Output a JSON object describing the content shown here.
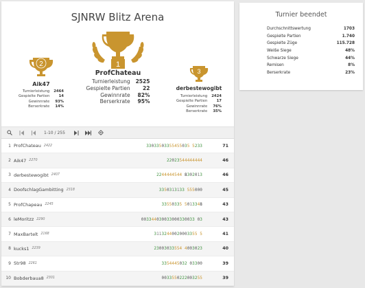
{
  "arena": {
    "title": "SJNRW Blitz Arena"
  },
  "podium": {
    "first": {
      "rank": "1",
      "name": "ProfChateau",
      "stats": [
        {
          "label": "Turnierleistung",
          "value": "2525"
        },
        {
          "label": "Gespielte Partien",
          "value": "22"
        },
        {
          "label": "Gewinnrate",
          "value": "82%"
        },
        {
          "label": "Berserkrate",
          "value": "95%"
        }
      ]
    },
    "second": {
      "rank": "2",
      "name": "Aik47",
      "stats": [
        {
          "label": "Turnierleistung",
          "value": "2464"
        },
        {
          "label": "Gespielte Partien",
          "value": "14"
        },
        {
          "label": "Gewinnrate",
          "value": "93%"
        },
        {
          "label": "Berserkrate",
          "value": "14%"
        }
      ]
    },
    "third": {
      "rank": "3",
      "name": "derbestewogibt",
      "stats": [
        {
          "label": "Turnierleistung",
          "value": "2424"
        },
        {
          "label": "Gespielte Partien",
          "value": "17"
        },
        {
          "label": "Gewinnrate",
          "value": "76%"
        },
        {
          "label": "Berserkrate",
          "value": "35%"
        }
      ]
    }
  },
  "toolbar": {
    "pagination": "1-10 / 255"
  },
  "standings": [
    {
      "rank": "1",
      "name": "ProfChateau",
      "rating": "2422",
      "scores": "33033503355455035 5233",
      "total": "71"
    },
    {
      "rank": "2",
      "name": "Aik47",
      "rating": "2270",
      "scores": "22023544444444",
      "total": "46"
    },
    {
      "rank": "3",
      "name": "derbestewogibt",
      "rating": "2407",
      "scores": "2244444544 8302013",
      "total": "46"
    },
    {
      "rank": "4",
      "name": "DoofschlagGambitting",
      "rating": "2318",
      "scores": "3350313133 555000",
      "total": "45"
    },
    {
      "rank": "5",
      "name": "ProfChapeau",
      "rating": "2245",
      "scores": "33550335 5013348",
      "total": "43"
    },
    {
      "rank": "6",
      "name": "leMoritzz",
      "rating": "2290",
      "scores": "003344030033000330033 03",
      "total": "43"
    },
    {
      "rank": "7",
      "name": "MaxBartelt",
      "rating": "2168",
      "scores": "31132440020003355 5",
      "total": "41"
    },
    {
      "rank": "8",
      "name": "kucks1",
      "rating": "2239",
      "scores": "23003033554 4003023",
      "total": "40"
    },
    {
      "rank": "9",
      "name": "Str98",
      "rating": "2261",
      "scores": "3354445032 03300",
      "total": "39"
    },
    {
      "rank": "10",
      "name": "Bobderbaua8",
      "rating": "2301",
      "scores": "0033550222003255",
      "total": "39"
    }
  ],
  "summary": {
    "title": "Turnier beendet",
    "rows": [
      {
        "label": "Durchschnittswertung",
        "value": "1703"
      },
      {
        "label": "Gespielte Partien",
        "value": "1.740"
      },
      {
        "label": "Gespielte Züge",
        "value": "115.728"
      },
      {
        "label": "Weiße Siege",
        "value": "48%"
      },
      {
        "label": "Schwarze Siege",
        "value": "44%"
      },
      {
        "label": "Remisen",
        "value": "8%"
      },
      {
        "label": "Berserkrate",
        "value": "23%"
      }
    ]
  },
  "colors": {
    "trophy": "#c9952f",
    "win_streak": "#3a8f3a",
    "accent": "#c9952f"
  }
}
